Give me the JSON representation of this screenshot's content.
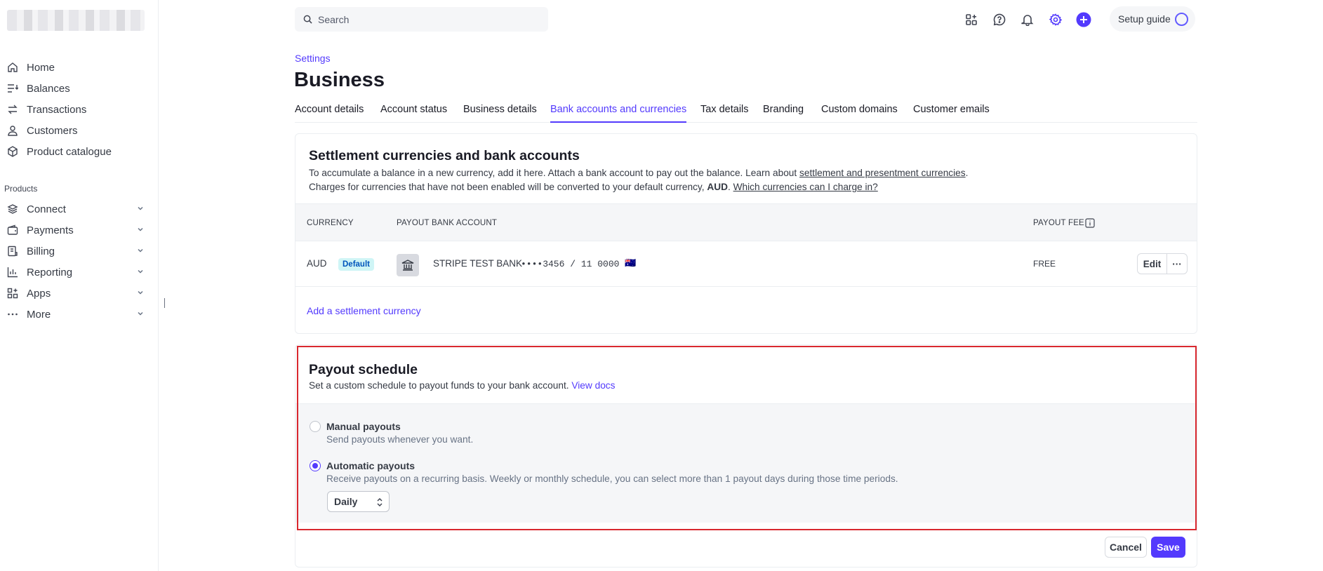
{
  "sidebar": {
    "account_name": "",
    "items": [
      {
        "label": "Home",
        "icon": "home-icon"
      },
      {
        "label": "Balances",
        "icon": "balances-icon"
      },
      {
        "label": "Transactions",
        "icon": "transactions-icon"
      },
      {
        "label": "Customers",
        "icon": "customers-icon"
      },
      {
        "label": "Product catalogue",
        "icon": "product-catalogue-icon"
      }
    ],
    "section_label": "Products",
    "products": [
      {
        "label": "Connect",
        "icon": "connect-icon"
      },
      {
        "label": "Payments",
        "icon": "payments-icon"
      },
      {
        "label": "Billing",
        "icon": "billing-icon"
      },
      {
        "label": "Reporting",
        "icon": "reporting-icon"
      },
      {
        "label": "Apps",
        "icon": "apps-icon"
      },
      {
        "label": "More",
        "icon": "more-icon"
      }
    ]
  },
  "topbar": {
    "search_placeholder": "Search",
    "setup_guide": "Setup guide",
    "accent": "#533afd"
  },
  "header": {
    "breadcrumb": "Settings",
    "title": "Business",
    "tabs": [
      {
        "label": "Account details"
      },
      {
        "label": "Account status"
      },
      {
        "label": "Business details"
      },
      {
        "label": "Bank accounts and currencies",
        "active": true
      },
      {
        "label": "Tax details"
      },
      {
        "label": "Branding"
      },
      {
        "label": "Custom domains"
      },
      {
        "label": "Customer emails"
      }
    ]
  },
  "settlement": {
    "title": "Settlement currencies and bank accounts",
    "line1_prefix": "To accumulate a balance in a new currency, add it here. Attach a bank account to pay out the balance. Learn about ",
    "line1_link": "settlement and presentment currencies",
    "line1_suffix": ".",
    "line2_prefix": "Charges for currencies that have not been enabled will be converted to your default currency, ",
    "line2_bold": "AUD",
    "line2_mid": ". ",
    "line2_link": "Which currencies can I charge in?",
    "columns": {
      "currency": "CURRENCY",
      "account": "PAYOUT BANK ACCOUNT",
      "fee": "PAYOUT FEE"
    },
    "rows": [
      {
        "currency": "AUD",
        "badge": "Default",
        "bank_name": "STRIPE TEST BANK",
        "account_number": "••••3456 / 11 0000",
        "flag": "🇦🇺",
        "fee": "FREE"
      }
    ],
    "edit_label": "Edit",
    "more_label": "···",
    "add_link": "Add a settlement currency"
  },
  "payout": {
    "title": "Payout schedule",
    "desc": "Set a custom schedule to payout funds to your bank account. ",
    "docs_link": "View docs",
    "options": [
      {
        "title": "Manual payouts",
        "desc": "Send payouts whenever you want.",
        "checked": false
      },
      {
        "title": "Automatic payouts",
        "desc": "Receive payouts on a recurring basis. Weekly or monthly schedule, you can select more than 1 payout days during those time periods.",
        "checked": true
      }
    ],
    "frequency": "Daily",
    "cancel_label": "Cancel",
    "save_label": "Save"
  }
}
